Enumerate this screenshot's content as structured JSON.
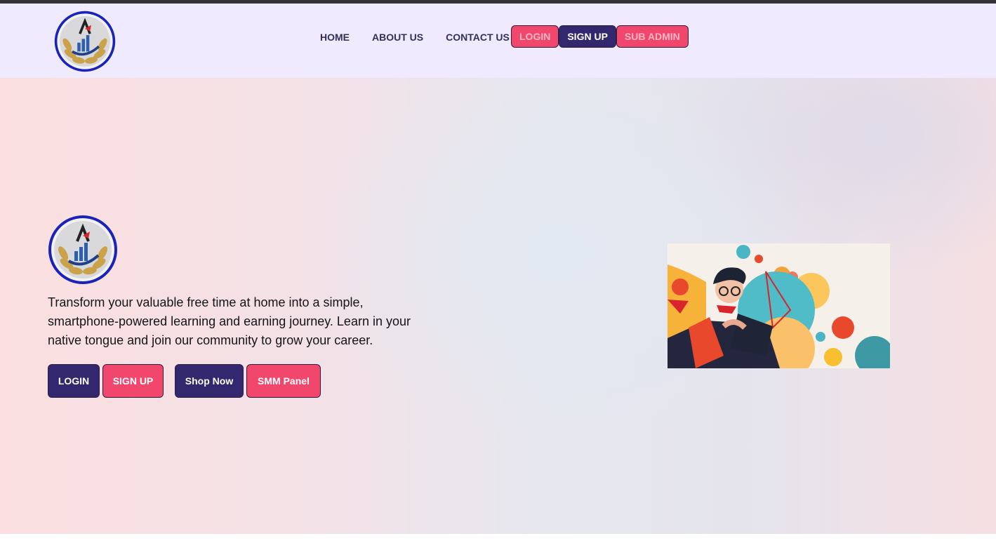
{
  "nav": {
    "links": [
      "HOME",
      "ABOUT US",
      "CONTACT US"
    ],
    "login_label": "LOGIN",
    "signup_label": "SIGN UP",
    "subadmin_label": "SUB ADMIN"
  },
  "hero": {
    "description": "Transform your valuable free time at home into a simple, smartphone-powered learning and earning journey. Learn in your native tongue and join our community to grow your career.",
    "buttons": {
      "login": "LOGIN",
      "signup": "SIGN UP",
      "shop": "Shop Now",
      "smm": "SMM Panel"
    }
  },
  "colors": {
    "navy": "#33276e",
    "pink": "#f2476c",
    "nav_bg": "#efeafd"
  },
  "icons": {
    "logo": "gold-laurel-growth-chart-logo",
    "illustration": "person-reading-tablet-with-data-charts"
  }
}
